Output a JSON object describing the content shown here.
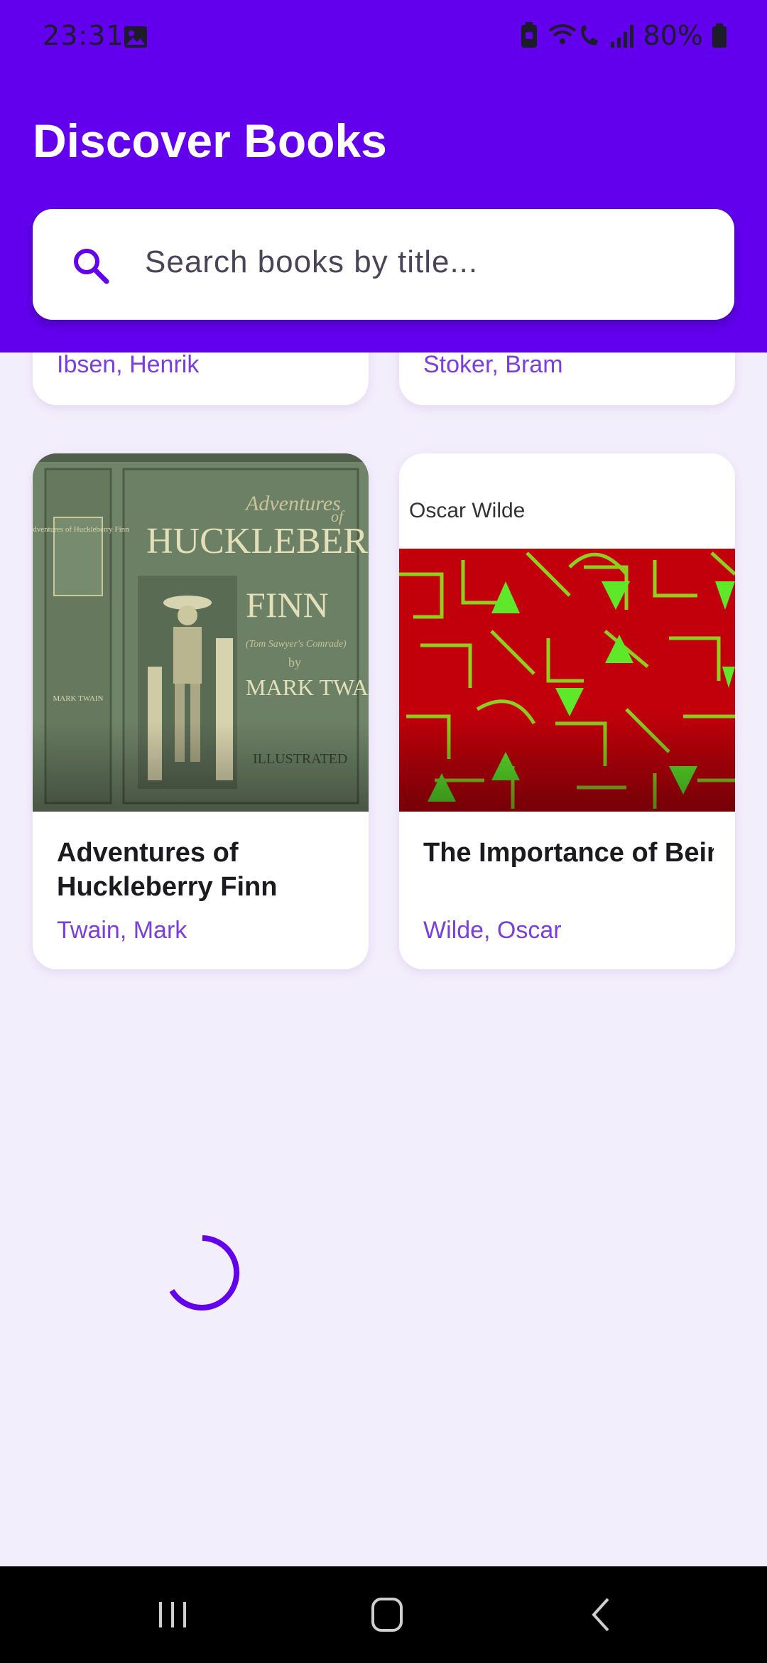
{
  "status_bar": {
    "time": "23:31",
    "battery_percent": "80%",
    "icons": [
      "gallery-icon",
      "battery-saver-icon",
      "wifi-calling-icon",
      "signal-icon",
      "battery-icon"
    ]
  },
  "header": {
    "title": "Discover Books",
    "background_color": "#6200ee"
  },
  "search": {
    "placeholder": "Search books by title...",
    "icon": "search-icon"
  },
  "books": [
    {
      "title": "",
      "author": "Ibsen, Henrik",
      "partially_visible": true
    },
    {
      "title": "",
      "author": "Stoker, Bram",
      "partially_visible": true
    },
    {
      "title": "Adventures of Huckleberry Finn",
      "author": "Twain, Mark",
      "cover_text": {
        "top": "Adventures",
        "of": "of",
        "main1": "HUCKLEBERRY",
        "main2": "FINN",
        "sub": "(Tom Sawyer's Comrade)",
        "by": "by",
        "author": "MARK TWAIN",
        "bottom": "ILLUSTRATED",
        "spine": "Adventures of Huckleberry Finn",
        "spine_author": "MARK TWAIN"
      }
    },
    {
      "title": "The Importance of Being Earnest: A Tri…",
      "author": "Wilde, Oscar",
      "cover_text": {
        "author": "Oscar Wilde"
      }
    }
  ],
  "loading": {
    "indicator": "progress-spinner",
    "color": "#6200ee"
  },
  "accent_color": "#7a3ee0",
  "nav_bar": {
    "buttons": [
      "recent-apps-icon",
      "home-icon",
      "back-icon"
    ]
  }
}
